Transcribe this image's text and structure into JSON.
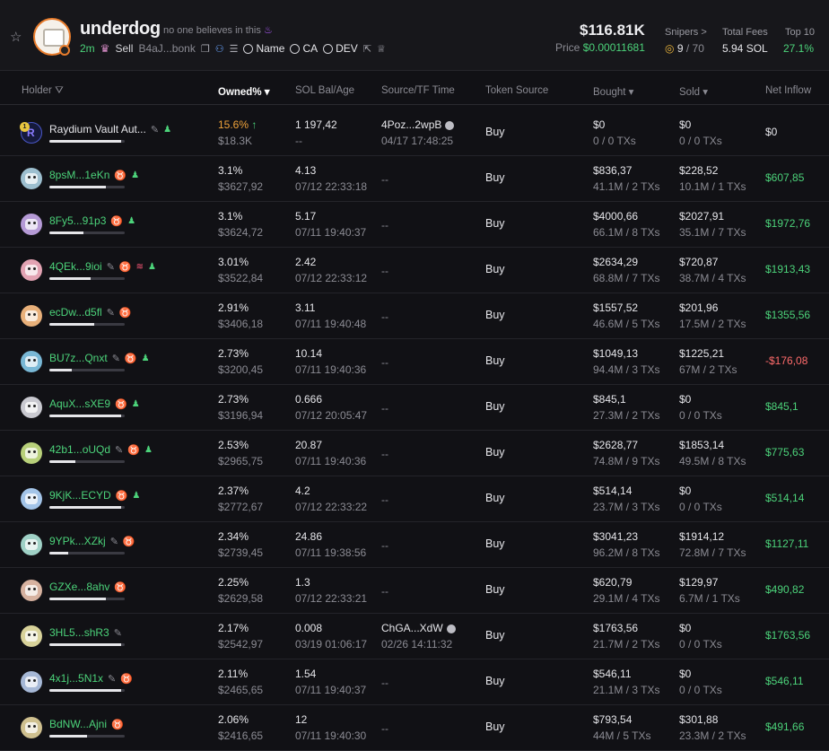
{
  "token": {
    "name": "underdog",
    "description": "no one believes in this",
    "age": "2m",
    "sell_label": "Sell",
    "address": "B4aJ...bonk",
    "links": [
      "Name",
      "CA",
      "DEV"
    ],
    "price_usd": "$116.81K",
    "price_label": "Price",
    "price_value": "$0.00011681",
    "snipers_label": "Snipers >",
    "snipers_value": "9",
    "snipers_total": "/ 70",
    "fees_label": "Total Fees",
    "fees_value": "5.94 SOL",
    "top10_label": "Top 10",
    "top10_value": "27.1%"
  },
  "columns": [
    "Holder",
    "Owned%",
    "SOL Bal/Age",
    "Source/TF Time",
    "Token Source",
    "Bought",
    "Sold",
    "Net Inflow"
  ],
  "holders": [
    {
      "name": "Raydium Vault Aut...",
      "owned": "15.6%",
      "owned_usd": "$18.3K",
      "sol": "1 197,42",
      "age": "--",
      "src": "4Poz...2wpB",
      "src_time": "04/17 17:48:25",
      "token_source": "Buy",
      "bought": "$0",
      "bought_tx": "0 / 0 TXs",
      "sold": "$0",
      "sold_tx": "0 / 0 TXs",
      "net": "$0",
      "bar": 0.95
    },
    {
      "name": "8psM...1eKn",
      "owned": "3.1%",
      "owned_usd": "$3627,92",
      "sol": "4.13",
      "age": "07/12 22:33:18",
      "src": "--",
      "src_time": "",
      "token_source": "Buy",
      "bought": "$836,37",
      "bought_tx": "41.1M / 2 TXs",
      "sold": "$228,52",
      "sold_tx": "10.1M / 1 TXs",
      "net": "$607,85",
      "bar": 0.75
    },
    {
      "name": "8Fy5...91p3",
      "owned": "3.1%",
      "owned_usd": "$3624,72",
      "sol": "5.17",
      "age": "07/11 19:40:37",
      "src": "--",
      "src_time": "",
      "token_source": "Buy",
      "bought": "$4000,66",
      "bought_tx": "66.1M / 8 TXs",
      "sold": "$2027,91",
      "sold_tx": "35.1M / 7 TXs",
      "net": "$1972,76",
      "bar": 0.45
    },
    {
      "name": "4QEk...9ioi",
      "owned": "3.01%",
      "owned_usd": "$3522,84",
      "sol": "2.42",
      "age": "07/12 22:33:12",
      "src": "--",
      "src_time": "",
      "token_source": "Buy",
      "bought": "$2634,29",
      "bought_tx": "68.8M / 7 TXs",
      "sold": "$720,87",
      "sold_tx": "38.7M / 4 TXs",
      "net": "$1913,43",
      "bar": 0.55
    },
    {
      "name": "ecDw...d5fl",
      "owned": "2.91%",
      "owned_usd": "$3406,18",
      "sol": "3.11",
      "age": "07/11 19:40:48",
      "src": "--",
      "src_time": "",
      "token_source": "Buy",
      "bought": "$1557,52",
      "bought_tx": "46.6M / 5 TXs",
      "sold": "$201,96",
      "sold_tx": "17.5M / 2 TXs",
      "net": "$1355,56",
      "bar": 0.6
    },
    {
      "name": "BU7z...Qnxt",
      "owned": "2.73%",
      "owned_usd": "$3200,45",
      "sol": "10.14",
      "age": "07/11 19:40:36",
      "src": "--",
      "src_time": "",
      "token_source": "Buy",
      "bought": "$1049,13",
      "bought_tx": "94.4M / 3 TXs",
      "sold": "$1225,21",
      "sold_tx": "67M / 2 TXs",
      "net": "-$176,08",
      "bar": 0.3
    },
    {
      "name": "AquX...sXE9",
      "owned": "2.73%",
      "owned_usd": "$3196,94",
      "sol": "0.666",
      "age": "07/12 20:05:47",
      "src": "--",
      "src_time": "",
      "token_source": "Buy",
      "bought": "$845,1",
      "bought_tx": "27.3M / 2 TXs",
      "sold": "$0",
      "sold_tx": "0 / 0 TXs",
      "net": "$845,1",
      "bar": 0.95
    },
    {
      "name": "42b1...oUQd",
      "owned": "2.53%",
      "owned_usd": "$2965,75",
      "sol": "20.87",
      "age": "07/11 19:40:36",
      "src": "--",
      "src_time": "",
      "token_source": "Buy",
      "bought": "$2628,77",
      "bought_tx": "74.8M / 9 TXs",
      "sold": "$1853,14",
      "sold_tx": "49.5M / 8 TXs",
      "net": "$775,63",
      "bar": 0.35
    },
    {
      "name": "9KjK...ECYD",
      "owned": "2.37%",
      "owned_usd": "$2772,67",
      "sol": "4.2",
      "age": "07/12 22:33:22",
      "src": "--",
      "src_time": "",
      "token_source": "Buy",
      "bought": "$514,14",
      "bought_tx": "23.7M / 3 TXs",
      "sold": "$0",
      "sold_tx": "0 / 0 TXs",
      "net": "$514,14",
      "bar": 0.95
    },
    {
      "name": "9YPk...XZkj",
      "owned": "2.34%",
      "owned_usd": "$2739,45",
      "sol": "24.86",
      "age": "07/11 19:38:56",
      "src": "--",
      "src_time": "",
      "token_source": "Buy",
      "bought": "$3041,23",
      "bought_tx": "96.2M / 8 TXs",
      "sold": "$1914,12",
      "sold_tx": "72.8M / 7 TXs",
      "net": "$1127,11",
      "bar": 0.25
    },
    {
      "name": "GZXe...8ahv",
      "owned": "2.25%",
      "owned_usd": "$2629,58",
      "sol": "1.3",
      "age": "07/12 22:33:21",
      "src": "--",
      "src_time": "",
      "token_source": "Buy",
      "bought": "$620,79",
      "bought_tx": "29.1M / 4 TXs",
      "sold": "$129,97",
      "sold_tx": "6.7M / 1 TXs",
      "net": "$490,82",
      "bar": 0.75
    },
    {
      "name": "3HL5...shR3",
      "owned": "2.17%",
      "owned_usd": "$2542,97",
      "sol": "0.008",
      "age": "03/19 01:06:17",
      "src": "ChGA...XdW",
      "src_time": "02/26 14:11:32",
      "token_source": "Buy",
      "bought": "$1763,56",
      "bought_tx": "21.7M / 2 TXs",
      "sold": "$0",
      "sold_tx": "0 / 0 TXs",
      "net": "$1763,56",
      "bar": 0.95
    },
    {
      "name": "4x1j...5N1x",
      "owned": "2.11%",
      "owned_usd": "$2465,65",
      "sol": "1.54",
      "age": "07/11 19:40:37",
      "src": "--",
      "src_time": "",
      "token_source": "Buy",
      "bought": "$546,11",
      "bought_tx": "21.1M / 3 TXs",
      "sold": "$0",
      "sold_tx": "0 / 0 TXs",
      "net": "$546,11",
      "bar": 0.95
    },
    {
      "name": "BdNW...Ajni",
      "owned": "2.06%",
      "owned_usd": "$2416,65",
      "sol": "12",
      "age": "07/11 19:40:30",
      "src": "--",
      "src_time": "",
      "token_source": "Buy",
      "bought": "$793,54",
      "bought_tx": "44M / 5 TXs",
      "sold": "$301,88",
      "sold_tx": "23.3M / 2 TXs",
      "net": "$491,66",
      "bar": 0.5
    }
  ],
  "colors": {
    "accent_green": "#4cd37a",
    "negative": "#ff6b6b",
    "highlight": "#f0a33a"
  }
}
